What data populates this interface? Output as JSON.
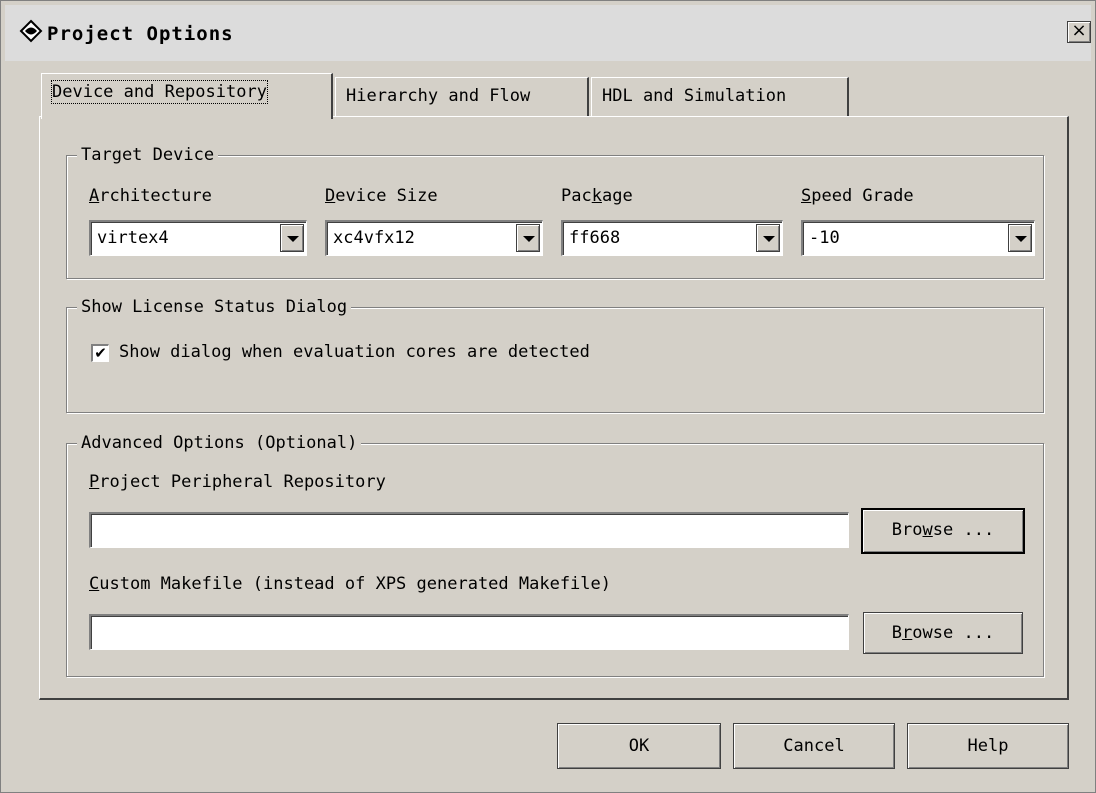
{
  "window": {
    "title": "Project Options",
    "close_label": "×"
  },
  "tabs": [
    {
      "label": "Device and Repository",
      "active": true
    },
    {
      "label": "Hierarchy and Flow",
      "active": false
    },
    {
      "label": "HDL and Simulation",
      "active": false
    }
  ],
  "target_device": {
    "title": "Target Device",
    "architecture": {
      "label_u": "A",
      "label_rest": "rchitecture",
      "value": "virtex4"
    },
    "device_size": {
      "label_u": "D",
      "label_rest": "evice Size",
      "value": "xc4vfx12"
    },
    "package": {
      "label_pre": "Pac",
      "label_u": "k",
      "label_rest": "age",
      "value": "ff668"
    },
    "speed_grade": {
      "label_u": "S",
      "label_rest": "peed Grade",
      "value": "-10"
    }
  },
  "license": {
    "title": "Show License Status Dialog",
    "checkbox_label": "Show dialog when evaluation cores are detected",
    "checked": true,
    "check_mark": "✔"
  },
  "advanced": {
    "title": "Advanced Options (Optional)",
    "repo_label_u": "P",
    "repo_label_rest": "roject Peripheral Repository",
    "repo_value": "",
    "browse1_pre": "Bro",
    "browse1_u": "w",
    "browse1_rest": "se ...",
    "makefile_label_u": "C",
    "makefile_label_rest": "ustom Makefile (instead of XPS generated Makefile)",
    "makefile_value": "",
    "browse2_pre": "B",
    "browse2_u": "r",
    "browse2_rest": "owse ..."
  },
  "footer": {
    "ok": "OK",
    "cancel": "Cancel",
    "help": "Help"
  }
}
